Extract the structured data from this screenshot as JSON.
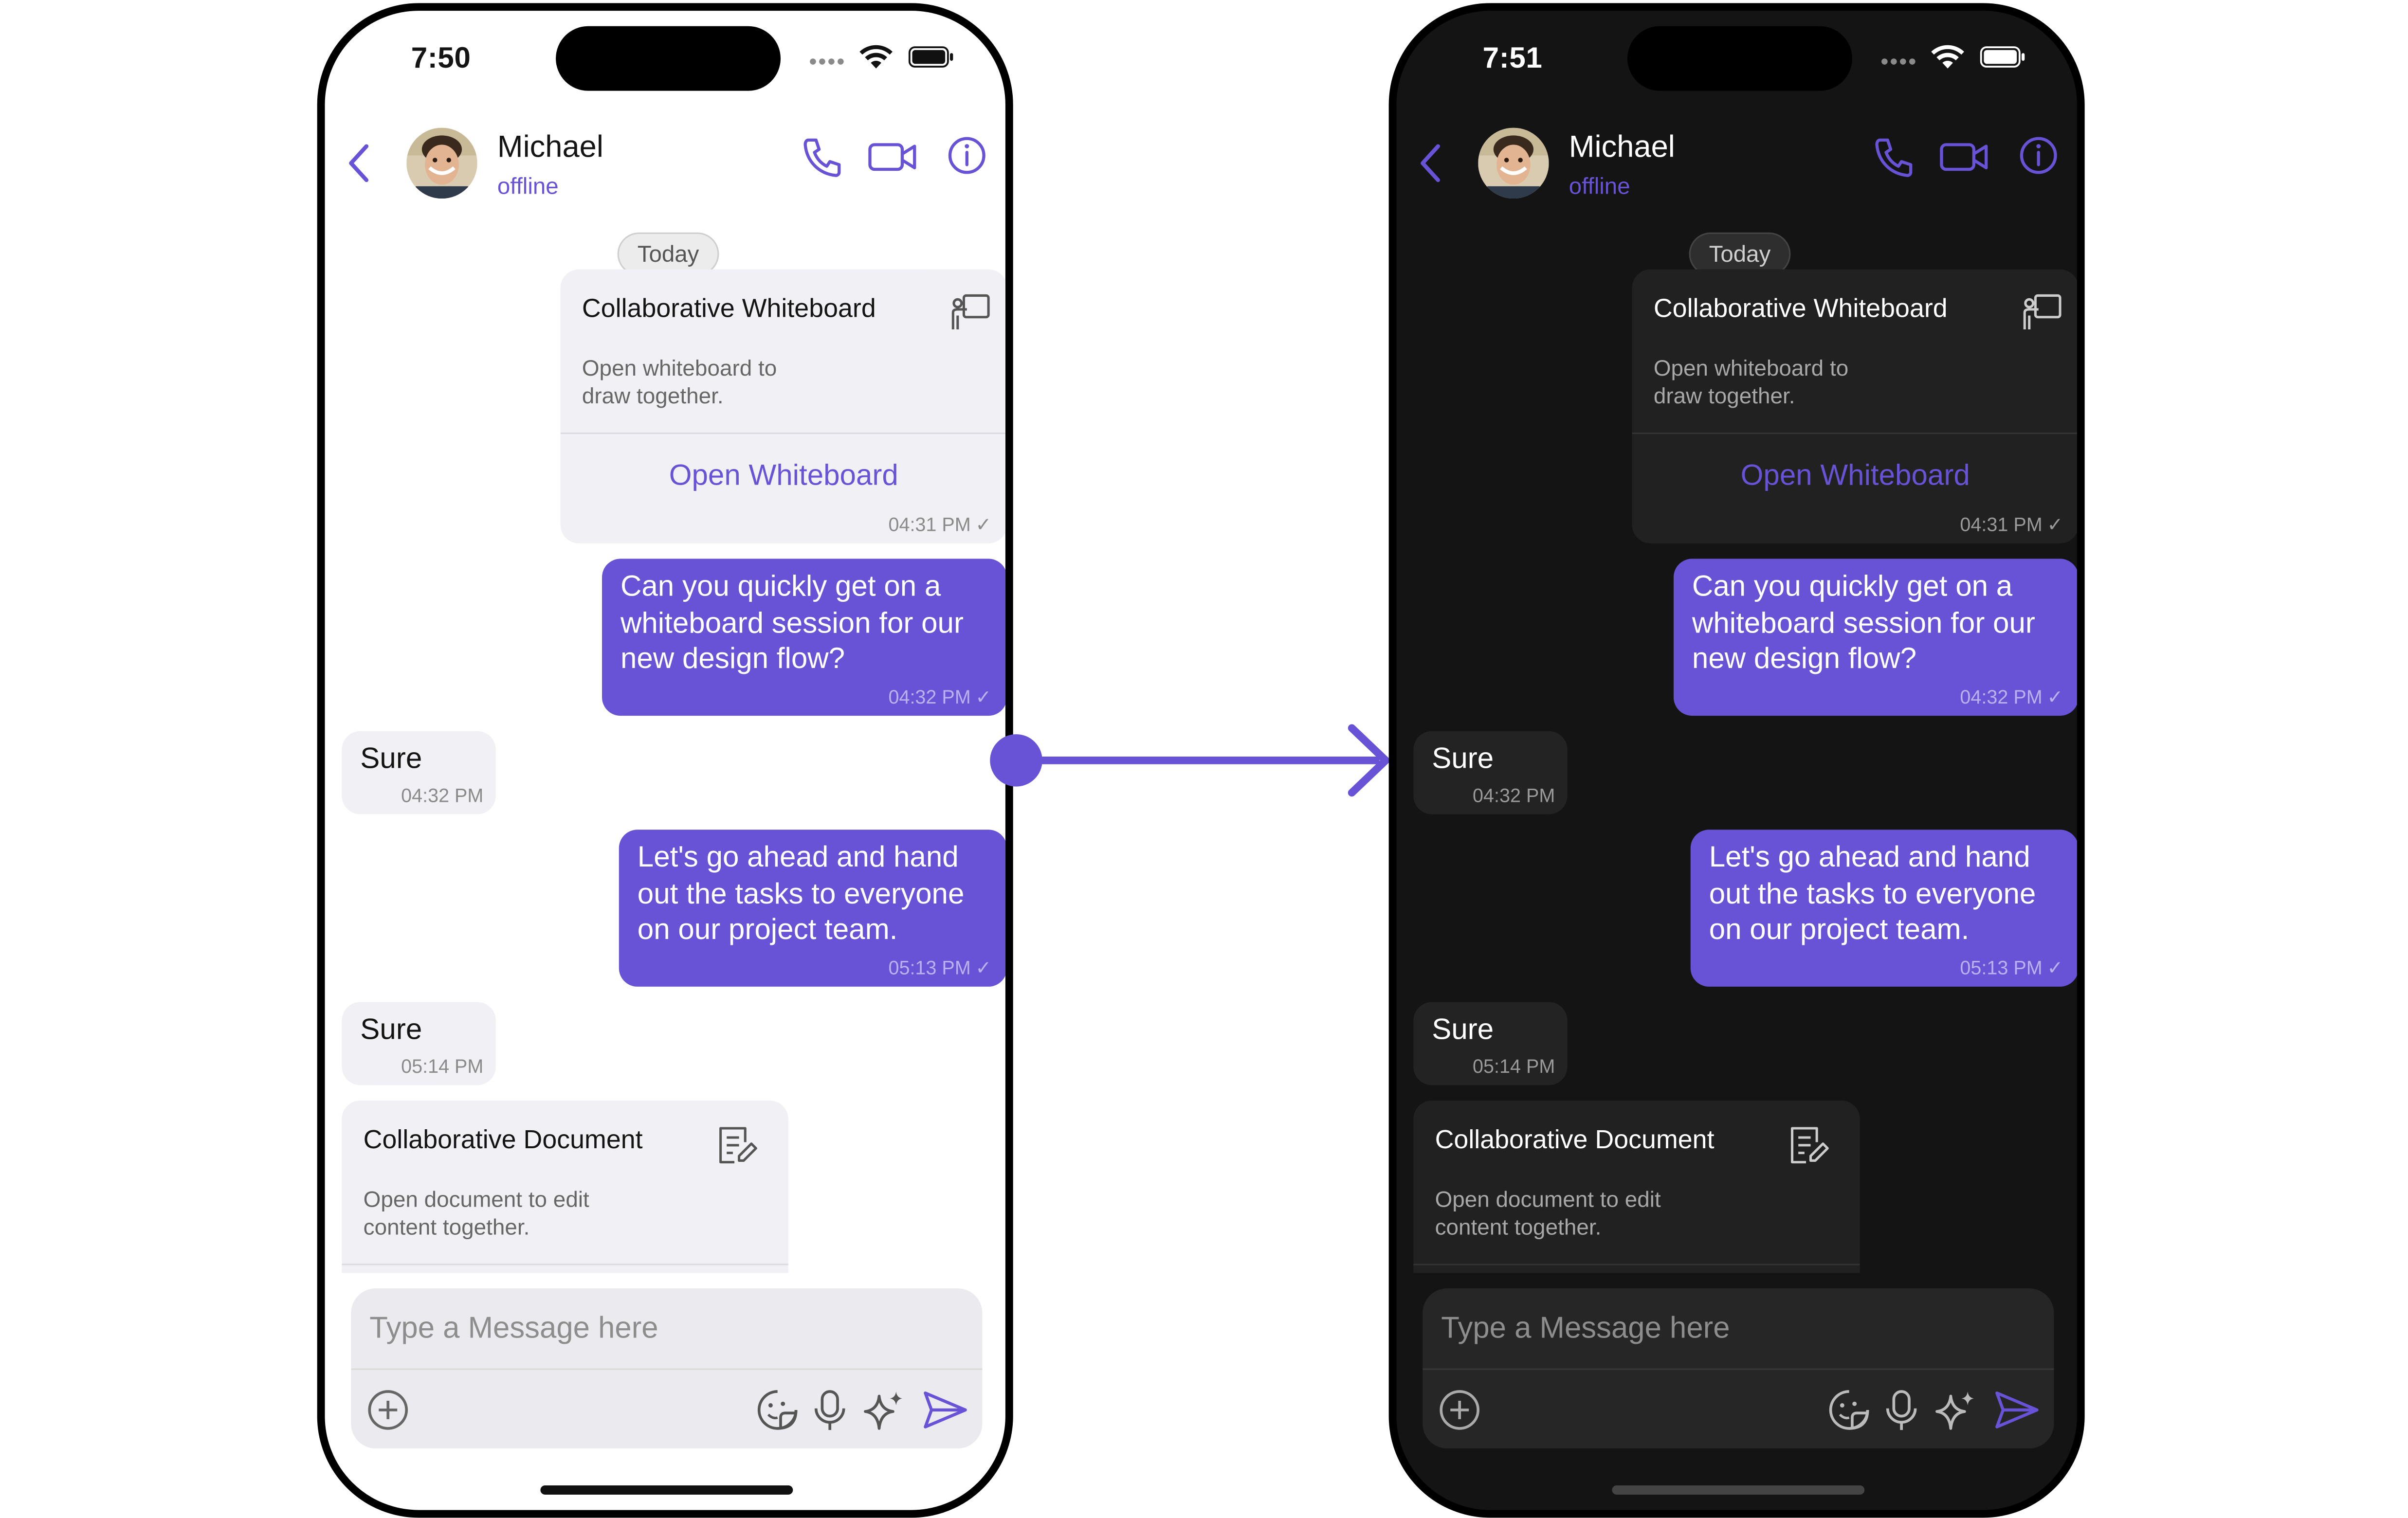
{
  "colors": {
    "accent": "#6852D6",
    "light_bg": "#ffffff",
    "dark_bg": "#141414"
  },
  "light": {
    "status": {
      "time": "7:50"
    },
    "header": {
      "name": "Michael",
      "status": "offline"
    },
    "date_separator": "Today",
    "whiteboard_card": {
      "title": "Collaborative Whiteboard",
      "desc_line1": "Open whiteboard to",
      "desc_line2": "draw together.",
      "action": "Open Whiteboard",
      "time": "04:31 PM"
    },
    "messages": [
      {
        "text_line1": "Can you quickly get on a",
        "text_line2": "whiteboard session for our",
        "text_line3": "new design flow?",
        "time": "04:32 PM"
      },
      {
        "text": "Sure",
        "time": "04:32 PM"
      },
      {
        "text_line1": "Let's go ahead and hand",
        "text_line2": "out the tasks to everyone",
        "text_line3": "on our project team.",
        "time": "05:13 PM"
      },
      {
        "text": "Sure",
        "time": "05:14 PM"
      }
    ],
    "document_card": {
      "title": "Collaborative Document",
      "desc_line1": "Open document to edit",
      "desc_line2": "content together."
    },
    "composer": {
      "placeholder": "Type a Message here"
    }
  },
  "dark": {
    "status": {
      "time": "7:51"
    },
    "header": {
      "name": "Michael",
      "status": "offline"
    },
    "date_separator": "Today",
    "whiteboard_card": {
      "title": "Collaborative Whiteboard",
      "desc_line1": "Open whiteboard to",
      "desc_line2": "draw together.",
      "action": "Open Whiteboard",
      "time": "04:31 PM"
    },
    "messages": [
      {
        "text_line1": "Can you quickly get on a",
        "text_line2": "whiteboard session for our",
        "text_line3": "new design flow?",
        "time": "04:32 PM"
      },
      {
        "text": "Sure",
        "time": "04:32 PM"
      },
      {
        "text_line1": "Let's go ahead and hand",
        "text_line2": "out the tasks to everyone",
        "text_line3": "on our project team.",
        "time": "05:13 PM"
      },
      {
        "text": "Sure",
        "time": "05:14 PM"
      }
    ],
    "document_card": {
      "title": "Collaborative Document",
      "desc_line1": "Open document to edit",
      "desc_line2": "content together."
    },
    "composer": {
      "placeholder": "Type a Message here"
    }
  },
  "icons": [
    "back-chevron-icon",
    "phone-call-icon",
    "video-call-icon",
    "info-icon",
    "whiteboard-icon",
    "document-edit-icon",
    "read-check-icon",
    "attach-plus-icon",
    "sticker-icon",
    "microphone-icon",
    "ai-sparkle-icon",
    "send-icon",
    "wifi-icon",
    "battery-icon",
    "signal-icon"
  ]
}
